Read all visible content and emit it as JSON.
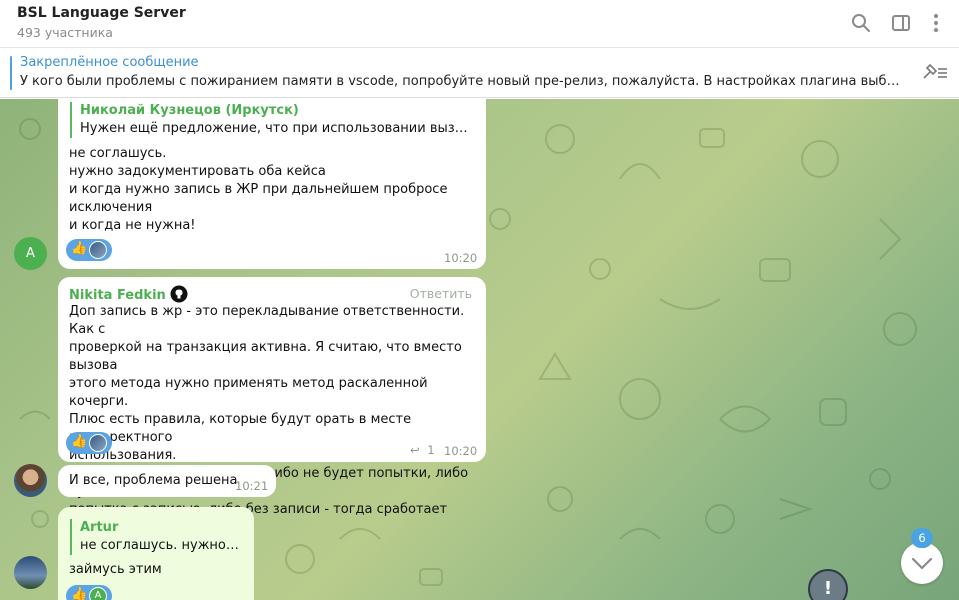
{
  "header": {
    "title": "BSL Language Server",
    "subtitle": "493 участника"
  },
  "pinned": {
    "label": "Закреплённое сообщение",
    "text": "У кого были проблемы с пожиранием памяти в vscode, попробуйте новый пре-релиз, пожалуйста. В настройках плагина выбрать release c..."
  },
  "messages": [
    {
      "reply_name": "Николай Кузнецов (Иркутск)",
      "reply_text": "Нужен ещё предложение, что при использовании вызова ис...",
      "lines": [
        "не соглашусь.",
        "нужно задокументировать оба кейса",
        "и когда нужно запись в ЖР при дальнейшем пробросе",
        "исключения",
        "и когда не нужна!"
      ],
      "time": "10:20",
      "avatar_letter": "A",
      "reaction": "👍"
    },
    {
      "sender": "Nikita Fedkin",
      "reply_action": "Ответить",
      "lines": [
        "Доп запись в жр - это перекладывание ответственности. Как с",
        "проверкой на транзакция активна. Я считаю, что вместо вызова",
        "этого метода нужно применять метод раскаленной кочерги.",
        "Плюс есть правила, которые будут орать в месте некорректного",
        "использования.",
        "Так и здесь - выше по стеку либо не будет попытки, либо будет",
        "попытка с записью, либо без записи - тогда сработает правило"
      ],
      "replies_count": "1",
      "time": "10:20",
      "reaction": "👍"
    },
    {
      "text": "И все, проблема решена",
      "time": "10:21"
    },
    {
      "reply_name": "Artur",
      "reply_text": "не соглашусь. нужно за...",
      "text": "займусь этим",
      "reaction": "👍",
      "reaction_letter": "A"
    }
  ],
  "scroll": {
    "unread_count": "6",
    "alert_glyph": "!"
  },
  "colors": {
    "accent": "#4ba3e2",
    "sender_green": "#4caf50"
  }
}
